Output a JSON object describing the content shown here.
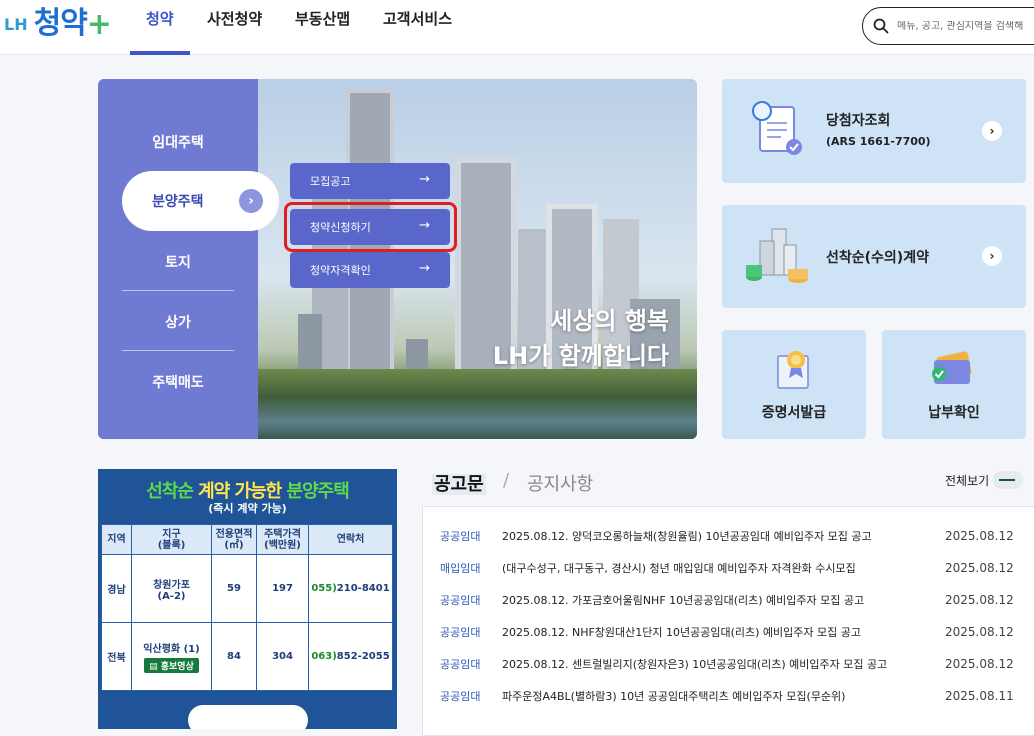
{
  "header": {
    "logo_lh": "LH",
    "logo_name": "청약",
    "logo_plus": "+",
    "nav": [
      "청약",
      "사전청약",
      "부동산맵",
      "고객서비스"
    ],
    "search_placeholder": "메뉴, 공고, 관심지역을 검색해"
  },
  "hero": {
    "side_menu": [
      "임대주택",
      "분양주택",
      "토지",
      "상가",
      "주택매도"
    ],
    "selected": "분양주택",
    "submenu": [
      "모집공고",
      "청약신청하기",
      "청약자격확인"
    ],
    "highlighted": "청약신청하기",
    "slogan_line1": "세상의 행복",
    "slogan_line2": "LH가 함께합니다"
  },
  "quick": {
    "winner_title": "당첨자조회",
    "winner_sub": "(ARS 1661-7700)",
    "contract_title": "선착순(수의)계약",
    "cert": "증명서발급",
    "payment": "납부확인"
  },
  "ad": {
    "title_a": "선착순",
    "title_b": "계약 가능한",
    "title_c": "분양주택",
    "subtitle": "(즉시 계약 가능)",
    "headers": [
      "지역",
      "지구\n(블록)",
      "전용면적\n(㎡)",
      "주택가격\n(백만원)",
      "연락처"
    ],
    "rows": [
      {
        "region": "경남",
        "district": "창원가포\n(A-2)",
        "area": "59",
        "price": "197",
        "phone_a": "055)",
        "phone_b": "210-8401",
        "video": ""
      },
      {
        "region": "전북",
        "district": "익산평화 (1)",
        "area": "84",
        "price": "304",
        "phone_a": "063)",
        "phone_b": "852-2055",
        "video": "홍보영상"
      }
    ]
  },
  "notice": {
    "tab_active": "공고문",
    "separator": "/",
    "tab_other": "공지사항",
    "more": "전체보기",
    "items": [
      {
        "cat": "공공임대",
        "title": "2025.08.12. 양덕코오롱하늘채(창원율림) 10년공공임대 예비입주자 모집 공고",
        "date": "2025.08.12"
      },
      {
        "cat": "매입임대",
        "title": "(대구수성구, 대구동구, 경산시) 청년 매입임대 예비입주자 자격완화 수시모집",
        "date": "2025.08.12"
      },
      {
        "cat": "공공임대",
        "title": "2025.08.12. 가포금호어울림NHF 10년공공임대(리츠) 예비입주자 모집 공고",
        "date": "2025.08.12"
      },
      {
        "cat": "공공임대",
        "title": "2025.08.12. NHF창원대산1단지 10년공공임대(리츠) 예비입주자 모집 공고",
        "date": "2025.08.12"
      },
      {
        "cat": "공공임대",
        "title": "2025.08.12. 센트럴빌리지(창원자은3) 10년공공임대(리츠) 예비입주자 모집 공고",
        "date": "2025.08.12"
      },
      {
        "cat": "공공임대",
        "title": "파주운정A4BL(별하람3) 10년 공공임대주택리츠 예비입주자 모집(무순위)",
        "date": "2025.08.11"
      }
    ]
  }
}
